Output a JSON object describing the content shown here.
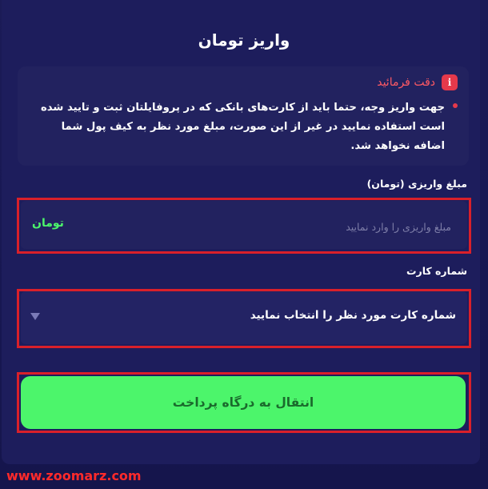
{
  "page": {
    "title": "واریز تومان"
  },
  "notice": {
    "title": "دقت فرمائید",
    "icon": "info-icon",
    "text": "جهت واریز وجه، حتما باید از کارت‌های بانکی که در پروفایلتان ثبت و تایید شده است استفاده نمایید در غیر از این صورت، مبلغ مورد نظر به کیف پول شما اضافه نخواهد شد."
  },
  "amount": {
    "label": "مبلغ واریزی (تومان)",
    "placeholder": "مبلغ واریزی را وارد نمایید",
    "value": "",
    "currency": "تومان"
  },
  "card": {
    "label": "شماره کارت",
    "selected": "شماره کارت مورد نظر را انتخاب نمایید"
  },
  "actions": {
    "pay_label": "انتقال به درگاه پرداخت"
  },
  "watermark": {
    "url": "www.zoomarz.com"
  },
  "colors": {
    "background": "#1b1b56",
    "accent_green": "#4cf56b",
    "warning_red": "#e5394b",
    "highlight_frame": "#d9202a"
  }
}
